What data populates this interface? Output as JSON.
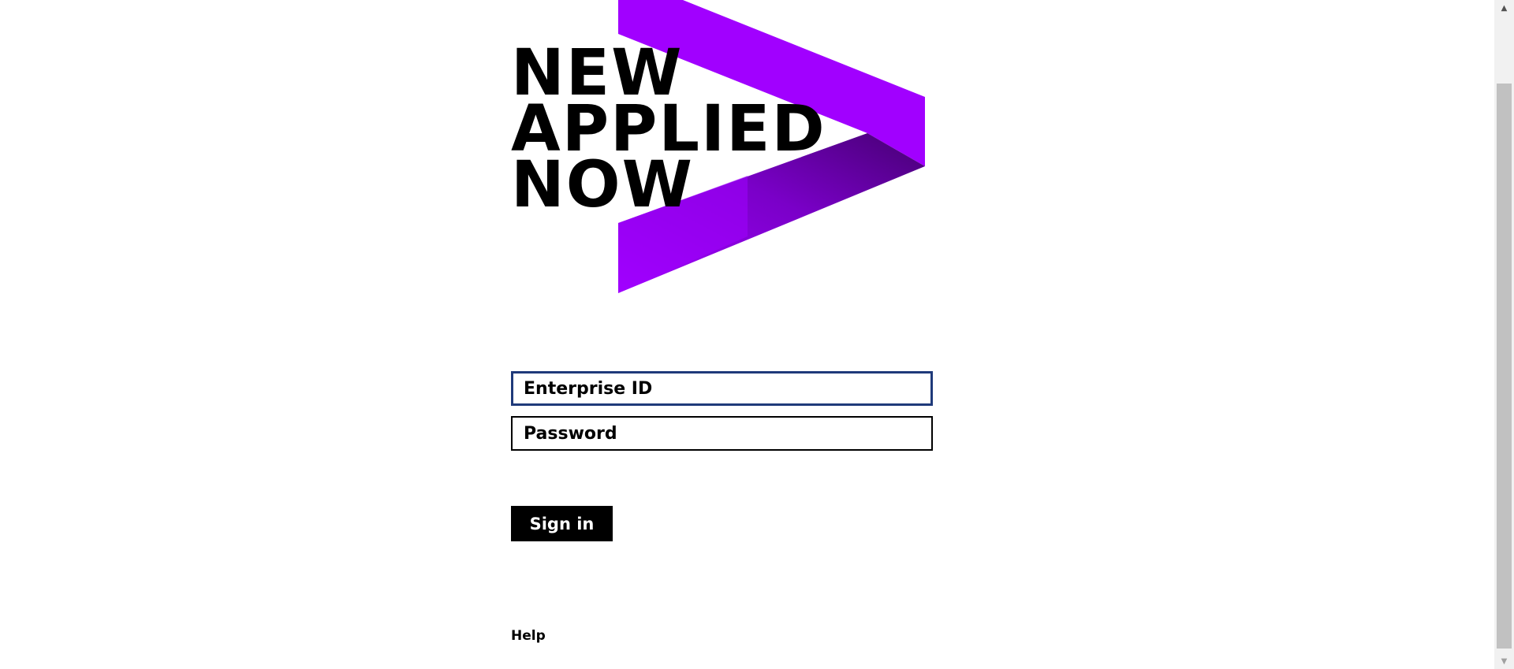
{
  "hero": {
    "lines": [
      "NEW",
      "APPLIED",
      "NOW"
    ],
    "logo_icon": "accenture-greater-than-icon",
    "colors": {
      "accent_purple": "#A100FF",
      "accent_dark_purple": "#460073"
    }
  },
  "form": {
    "enterprise_id": {
      "placeholder": "Enterprise ID",
      "value": ""
    },
    "password": {
      "placeholder": "Password",
      "value": ""
    },
    "sign_in_label": "Sign in"
  },
  "footer": {
    "help_label": "Help"
  },
  "scrollbar": {
    "up_icon": "scroll-up-arrow-icon",
    "down_icon": "scroll-down-arrow-icon"
  }
}
